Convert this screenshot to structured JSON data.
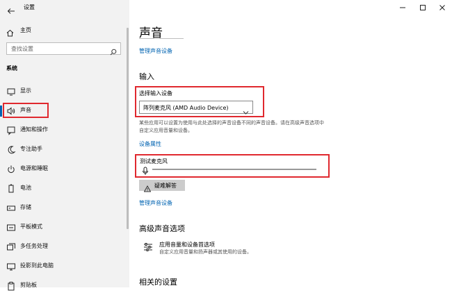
{
  "window": {
    "title": "设置",
    "back_icon": "back-arrow-icon",
    "controls": [
      "minimize-icon",
      "maximize-icon",
      "close-icon"
    ]
  },
  "sidebar": {
    "home_label": "主页",
    "search_placeholder": "查找设置",
    "section_label": "系统",
    "items": [
      {
        "label": "显示",
        "icon": "display-icon"
      },
      {
        "label": "声音",
        "icon": "speaker-icon",
        "selected": true
      },
      {
        "label": "通知和操作",
        "icon": "notification-icon"
      },
      {
        "label": "专注助手",
        "icon": "moon-icon"
      },
      {
        "label": "电源和睡眠",
        "icon": "power-icon"
      },
      {
        "label": "电池",
        "icon": "battery-icon"
      },
      {
        "label": "存储",
        "icon": "storage-icon"
      },
      {
        "label": "平板模式",
        "icon": "tablet-icon"
      },
      {
        "label": "多任务处理",
        "icon": "multitask-icon"
      },
      {
        "label": "投影到此电脑",
        "icon": "project-icon"
      },
      {
        "label": "剪贴板",
        "icon": "clipboard-icon"
      }
    ]
  },
  "main": {
    "page_title": "声音",
    "manage_devices_link_top": "管理声音设备",
    "input_heading": "输入",
    "choose_input_label": "选择输入设备",
    "input_device_value": "阵列麦克风 (AMD Audio Device)",
    "input_description": "某些应用可以设置为使用与此处选择的声音设备不同的声音设备。请在高级声音选项中自定义应用音量和设备。",
    "device_properties_link": "设备属性",
    "test_mic_label": "测试麦克风",
    "mic_level": 0.0,
    "troubleshoot_label": "疑难解答",
    "manage_devices_link_bottom": "管理声音设备",
    "advanced_heading": "高级声音选项",
    "app_volume_title": "应用音量和设备首选项",
    "app_volume_desc": "自定义应用音量和扬声器或其使用的设备。",
    "related_heading": "相关的设置"
  },
  "colors": {
    "accent": "#0063b1",
    "highlight_box": "#e0282e",
    "sidebar_bg": "#f2f2f2"
  }
}
